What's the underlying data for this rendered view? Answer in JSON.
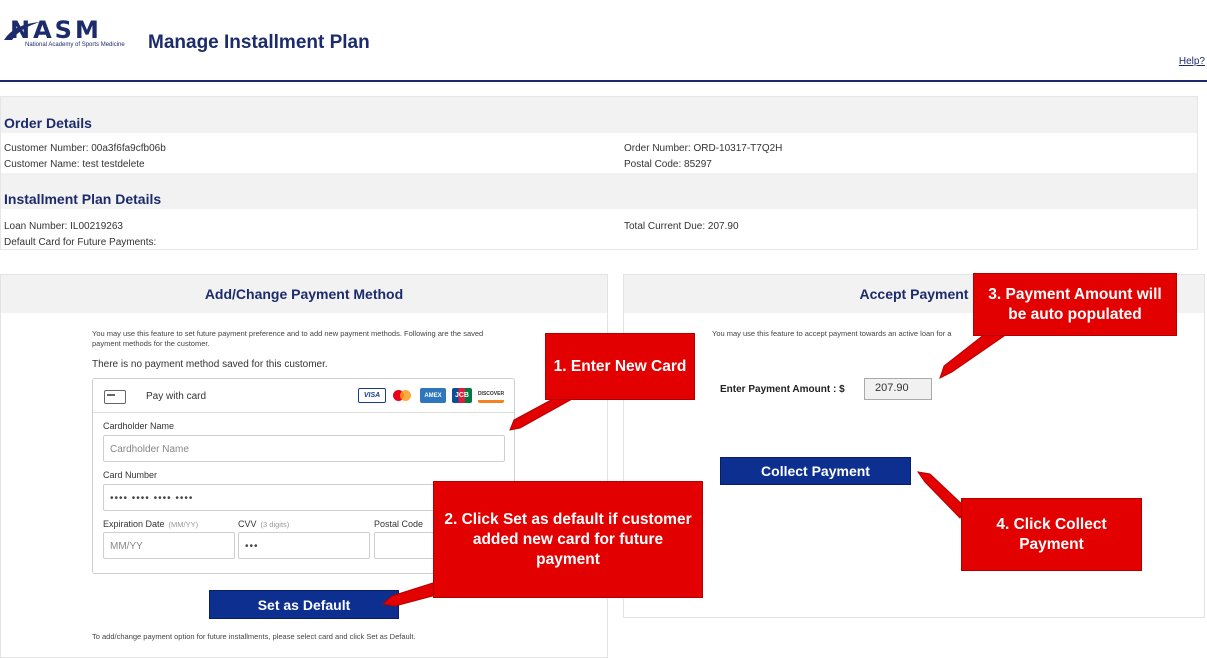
{
  "header": {
    "logo_text": "NASM",
    "logo_subtext": "National Academy of Sports Medicine",
    "title": "Manage Installment Plan",
    "help": "Help?"
  },
  "order_details": {
    "heading": "Order Details",
    "customer_number": "Customer Number: 00a3f6fa9cfb06b",
    "customer_name": "Customer Name: test testdelete",
    "order_number": "Order Number: ORD-10317-T7Q2H",
    "postal_code": "Postal Code: 85297"
  },
  "installment_details": {
    "heading": "Installment Plan Details",
    "loan_number": "Loan Number: IL00219263",
    "default_card": "Default Card for Future Payments:",
    "total_due": "Total Current Due: 207.90"
  },
  "payment_method": {
    "heading": "Add/Change Payment Method",
    "intro": "You may use this feature to set future payment preference and to add new payment methods. Following are the saved payment methods for the customer.",
    "no_method": "There is no payment method saved for this customer.",
    "pay_with_card": "Pay with card",
    "brands": [
      "VISA",
      "mastercard",
      "AMEX",
      "JCB",
      "DISCOVER"
    ],
    "cardholder_label": "Cardholder Name",
    "cardholder_placeholder": "Cardholder Name",
    "card_number_label": "Card Number",
    "card_number_value": "•••• •••• •••• ••••",
    "expiration_label": "Expiration Date",
    "expiration_hint": "(MM/YY)",
    "expiration_placeholder": "MM/YY",
    "cvv_label": "CVV",
    "cvv_hint": "(3 digits)",
    "cvv_value": "•••",
    "postal_label": "Postal Code",
    "set_default_button": "Set as Default",
    "footnote": "To add/change payment option for future installments, please select card and click Set as Default."
  },
  "accept_payment": {
    "heading": "Accept Payment",
    "intro": "You may use this feature to accept payment towards an active loan for a",
    "amount_label": "Enter Payment Amount : $",
    "amount_value": "207.90",
    "collect_button": "Collect Payment"
  },
  "callouts": {
    "step1": "1. Enter New Card",
    "step2": "2. Click Set as default if customer added new card for future payment",
    "step3": "3. Payment Amount will be auto populated",
    "step4": "4. Click Collect Payment"
  },
  "colors": {
    "brand_navy": "#1c2b6b",
    "button_blue": "#0d2f8f",
    "callout_red": "#e30000"
  }
}
